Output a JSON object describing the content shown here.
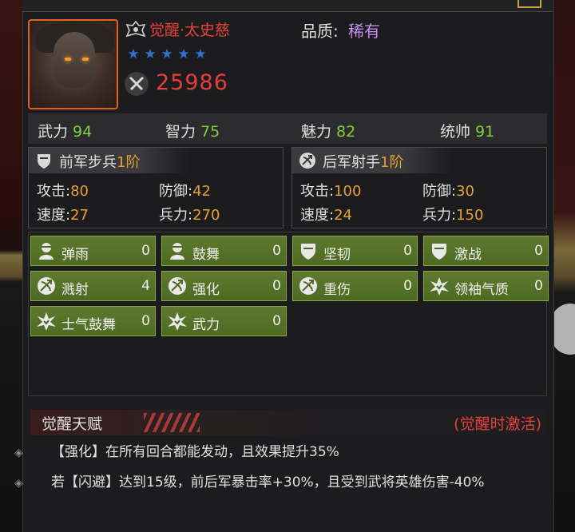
{
  "hero": {
    "name": "觉醒·太史慈",
    "quality_label": "品质:",
    "quality_value": "稀有",
    "stars": 5,
    "power": "25986",
    "icons": {
      "rank": "rank-badge-icon",
      "power": "crossed-swords-icon",
      "star": "star-icon"
    }
  },
  "attributes": [
    {
      "label": "武力",
      "value": "94"
    },
    {
      "label": "智力",
      "value": "75"
    },
    {
      "label": "魅力",
      "value": "82"
    },
    {
      "label": "统帅",
      "value": "91"
    }
  ],
  "troops": [
    {
      "title": "前军步兵",
      "level": "1阶",
      "icon": "shield-icon",
      "stats": [
        {
          "label": "攻击:",
          "value": "80"
        },
        {
          "label": "防御:",
          "value": "42"
        },
        {
          "label": "速度:",
          "value": "27"
        },
        {
          "label": "兵力:",
          "value": "270"
        }
      ]
    },
    {
      "title": "后军射手",
      "level": "1阶",
      "icon": "archer-icon",
      "stats": [
        {
          "label": "攻击:",
          "value": "100"
        },
        {
          "label": "防御:",
          "value": "30"
        },
        {
          "label": "速度:",
          "value": "24"
        },
        {
          "label": "兵力:",
          "value": "150"
        }
      ]
    }
  ],
  "skills": [
    {
      "name": "弹雨",
      "count": "0",
      "icon": "soldier-icon"
    },
    {
      "name": "鼓舞",
      "count": "0",
      "icon": "soldier-icon"
    },
    {
      "name": "坚韧",
      "count": "0",
      "icon": "shield-icon"
    },
    {
      "name": "激战",
      "count": "0",
      "icon": "shield-icon"
    },
    {
      "name": "溅射",
      "count": "4",
      "icon": "archer-icon"
    },
    {
      "name": "强化",
      "count": "0",
      "icon": "archer-icon"
    },
    {
      "name": "重伤",
      "count": "0",
      "icon": "archer-icon"
    },
    {
      "name": "领袖气质",
      "count": "0",
      "icon": "burst-star-icon"
    },
    {
      "name": "士气鼓舞",
      "count": "0",
      "icon": "burst-star-icon"
    },
    {
      "name": "武力",
      "count": "0",
      "icon": "burst-star-icon"
    }
  ],
  "talent": {
    "title": "觉醒天赋",
    "note": "(觉醒时激活)",
    "lines": [
      "【强化】在所有回合都能发动，且效果提升35%",
      "若【闪避】达到15级，前后军暴击率+30%，且受到武将英雄伤害-40%"
    ]
  },
  "colors": {
    "accent_red": "#e8403c",
    "stat_green": "#7fcf3f",
    "stat_orange": "#e8a030",
    "rare_purple": "#c88ef0",
    "skill_green": "#4c6a22"
  }
}
